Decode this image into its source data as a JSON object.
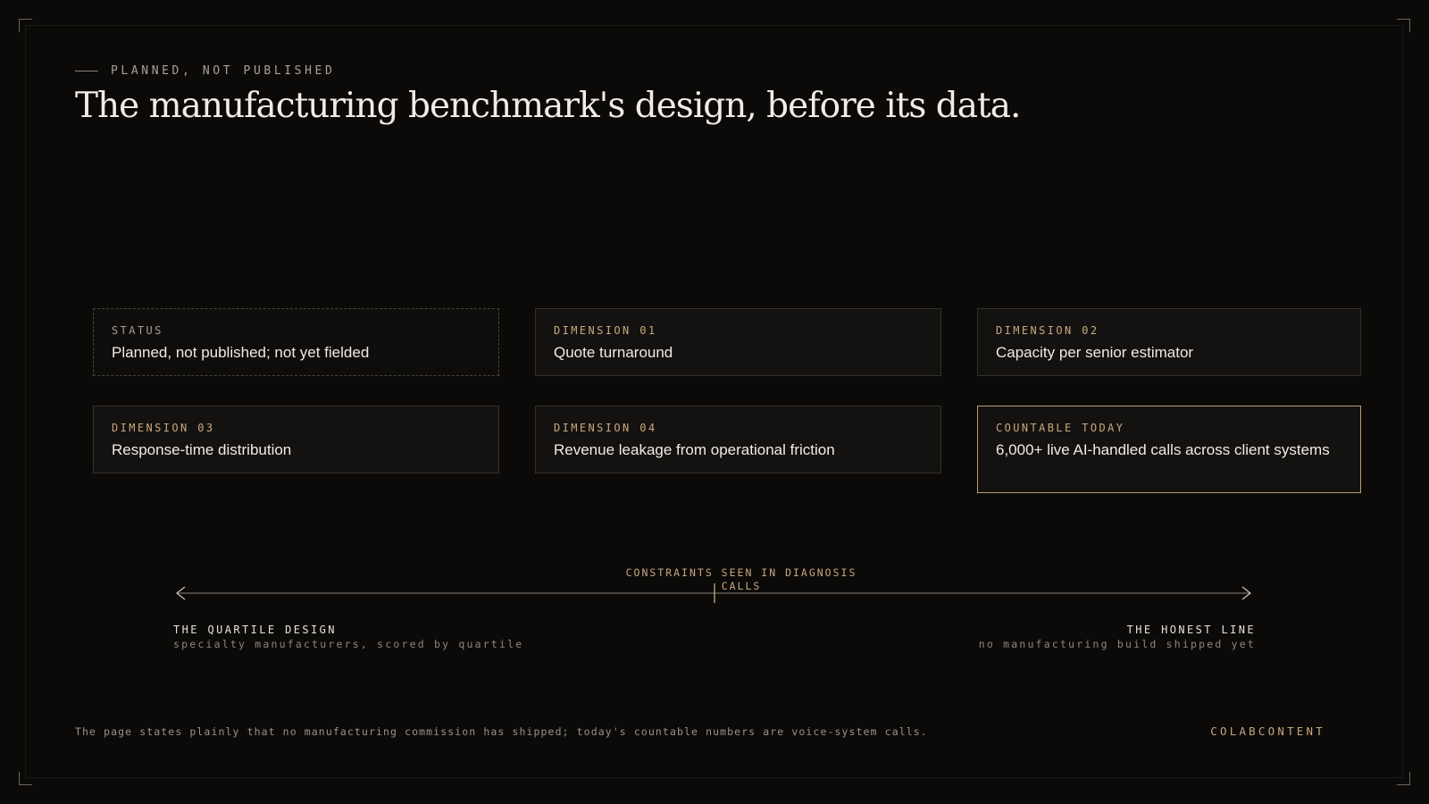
{
  "header": {
    "eyebrow": "PLANNED, NOT PUBLISHED",
    "title": "The manufacturing benchmark's design, before its data."
  },
  "cards": [
    {
      "label": "STATUS",
      "value": "Planned, not published; not yet fielded"
    },
    {
      "label": "DIMENSION 01",
      "value": "Quote turnaround"
    },
    {
      "label": "DIMENSION 02",
      "value": "Capacity per senior estimator"
    },
    {
      "label": "DIMENSION 03",
      "value": "Response-time distribution"
    },
    {
      "label": "DIMENSION 04",
      "value": "Revenue leakage from operational friction"
    },
    {
      "label": "COUNTABLE TODAY",
      "value": "6,000+ live AI-handled calls across client systems"
    }
  ],
  "axis": {
    "center_caption": "CONSTRAINTS SEEN IN DIAGNOSIS CALLS",
    "left_title": "THE QUARTILE DESIGN",
    "left_subtitle": "specialty manufacturers, scored by quartile",
    "right_title": "THE HONEST LINE",
    "right_subtitle": "no manufacturing build shipped yet"
  },
  "footer": {
    "note": "The page states plainly that no manufacturing commission has shipped; today's countable numbers are voice-system calls.",
    "brand": "COLABCONTENT"
  },
  "colors": {
    "background": "#0b0a09",
    "accent": "#c9a77e",
    "highlight_border": "#b89c73",
    "text": "#f0ebe3"
  }
}
